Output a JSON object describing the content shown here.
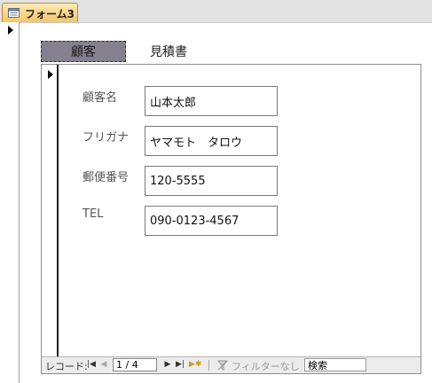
{
  "document_tab": {
    "label": "フォーム3",
    "icon": "form-icon"
  },
  "tabs": [
    {
      "label": "顧客",
      "active": true
    },
    {
      "label": "見積書",
      "active": false
    }
  ],
  "fields": {
    "customer_name": {
      "label": "顧客名",
      "value": "山本太郎"
    },
    "furigana": {
      "label": "フリガナ",
      "value": "ヤマモト　タロウ"
    },
    "postal_code": {
      "label": "郵便番号",
      "value": "120-5555"
    },
    "tel": {
      "label": "TEL",
      "value": "090-0123-4567"
    }
  },
  "navigation": {
    "record_label": "レコード:",
    "current": "1 / 4",
    "filter_label": "フィルターなし",
    "search_placeholder": "検索"
  },
  "colors": {
    "tab_active": "#f6c567",
    "tab_customer_bg": "#85808f"
  }
}
